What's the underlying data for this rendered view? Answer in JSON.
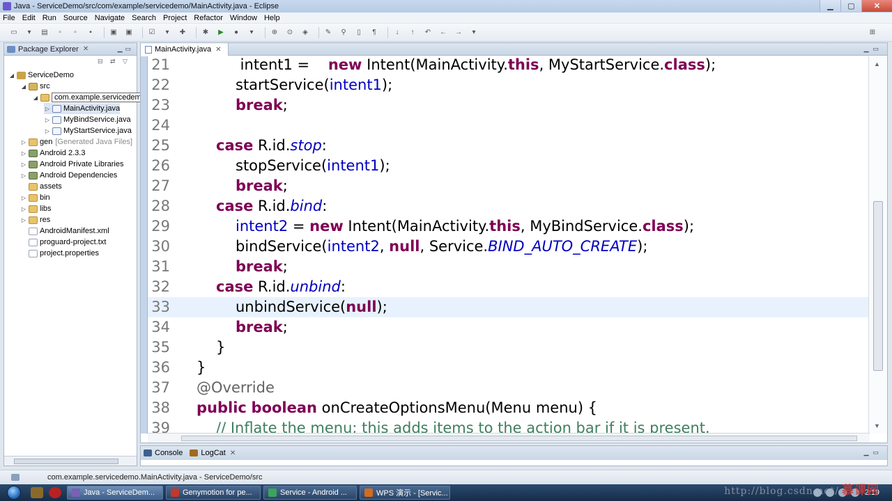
{
  "window": {
    "title": "Java - ServiceDemo/src/com/example/servicedemo/MainActivity.java - Eclipse",
    "controls": [
      "▁",
      "▢",
      "✕"
    ]
  },
  "menu": [
    "File",
    "Edit",
    "Run",
    "Source",
    "Navigate",
    "Search",
    "Project",
    "Refactor",
    "Window",
    "Help"
  ],
  "package_explorer": {
    "tab_label": "Package Explorer",
    "tab_close": "✕",
    "tree": [
      {
        "label": "ServiceDemo",
        "arrow": "◢",
        "icon": "project-icon"
      },
      {
        "label": "src",
        "arrow": "◢",
        "icon": "source-folder-icon"
      },
      {
        "label": "com.example.servicedemo",
        "arrow": "◢",
        "icon": "package-icon"
      },
      {
        "label": "MainActivity.java",
        "arrow": "▷",
        "icon": "java-file-icon"
      },
      {
        "label": "MyBindService.java",
        "arrow": "▷",
        "icon": "java-file-icon"
      },
      {
        "label": "MyStartService.java",
        "arrow": "▷",
        "icon": "java-file-icon"
      },
      {
        "label": "gen",
        "extra": "[Generated Java Files]",
        "arrow": "▷",
        "icon": "folder-icon"
      },
      {
        "label": "Android 2.3.3",
        "arrow": "▷",
        "icon": "library-icon"
      },
      {
        "label": "Android Private Libraries",
        "arrow": "▷",
        "icon": "library-icon"
      },
      {
        "label": "Android Dependencies",
        "arrow": "▷",
        "icon": "library-icon"
      },
      {
        "label": "assets",
        "arrow": "",
        "icon": "folder-icon"
      },
      {
        "label": "bin",
        "arrow": "▷",
        "icon": "folder-icon"
      },
      {
        "label": "libs",
        "arrow": "▷",
        "icon": "folder-icon"
      },
      {
        "label": "res",
        "arrow": "▷",
        "icon": "folder-icon"
      },
      {
        "label": "AndroidManifest.xml",
        "arrow": "",
        "icon": "xml-file-icon"
      },
      {
        "label": "proguard-project.txt",
        "arrow": "",
        "icon": "text-file-icon"
      },
      {
        "label": "project.properties",
        "arrow": "",
        "icon": "properties-file-icon"
      }
    ]
  },
  "editor": {
    "tab_label": "MainActivity.java",
    "tab_close": "✕",
    "current_line": 33,
    "lines": [
      {
        "num": "21",
        "tokens": [
          [
            "",
            " intent1 =    "
          ],
          [
            "kw",
            "new"
          ],
          [
            "",
            " Intent(MainActivity."
          ],
          [
            "kw",
            "this"
          ],
          [
            "",
            ", MyStartService."
          ],
          [
            "kw",
            "class"
          ],
          [
            "",
            ");"
          ]
        ],
        "indent": 2
      },
      {
        "num": "22",
        "tokens": [
          [
            "",
            "startService("
          ],
          [
            "var",
            "intent1"
          ],
          [
            "",
            ");"
          ]
        ],
        "indent": 2
      },
      {
        "num": "23",
        "tokens": [
          [
            "kw",
            "break"
          ],
          [
            "",
            ";"
          ]
        ],
        "indent": 2
      },
      {
        "num": "24",
        "tokens": [],
        "indent": 0
      },
      {
        "num": "25",
        "tokens": [
          [
            "kw",
            "case"
          ],
          [
            "",
            " R.id."
          ],
          [
            "ital",
            "stop"
          ],
          [
            "",
            ":"
          ]
        ],
        "indent": 1
      },
      {
        "num": "26",
        "tokens": [
          [
            "",
            "stopService("
          ],
          [
            "var",
            "intent1"
          ],
          [
            "",
            ");"
          ]
        ],
        "indent": 2
      },
      {
        "num": "27",
        "tokens": [
          [
            "kw",
            "break"
          ],
          [
            "",
            ";"
          ]
        ],
        "indent": 2
      },
      {
        "num": "28",
        "tokens": [
          [
            "kw",
            "case"
          ],
          [
            "",
            " R.id."
          ],
          [
            "ital",
            "bind"
          ],
          [
            "",
            ":"
          ]
        ],
        "indent": 1
      },
      {
        "num": "29",
        "tokens": [
          [
            "var",
            "intent2"
          ],
          [
            "",
            " = "
          ],
          [
            "kw",
            "new"
          ],
          [
            "",
            " Intent(MainActivity."
          ],
          [
            "kw",
            "this"
          ],
          [
            "",
            ", MyBindService."
          ],
          [
            "kw",
            "class"
          ],
          [
            "",
            ");"
          ]
        ],
        "indent": 2
      },
      {
        "num": "30",
        "tokens": [
          [
            "",
            "bindService("
          ],
          [
            "var",
            "intent2"
          ],
          [
            "",
            ", "
          ],
          [
            "kw",
            "null"
          ],
          [
            "",
            ", Service."
          ],
          [
            "ital",
            "BIND_AUTO_CREATE"
          ],
          [
            "",
            ");"
          ]
        ],
        "indent": 2
      },
      {
        "num": "31",
        "tokens": [
          [
            "kw",
            "break"
          ],
          [
            "",
            ";"
          ]
        ],
        "indent": 2
      },
      {
        "num": "32",
        "tokens": [
          [
            "kw",
            "case"
          ],
          [
            "",
            " R.id."
          ],
          [
            "ital",
            "unbind"
          ],
          [
            "",
            ":"
          ]
        ],
        "indent": 1
      },
      {
        "num": "33",
        "tokens": [
          [
            "",
            "unbindService("
          ],
          [
            "kw",
            "null"
          ],
          [
            "",
            ");"
          ]
        ],
        "indent": 2
      },
      {
        "num": "34",
        "tokens": [
          [
            "kw",
            "break"
          ],
          [
            "",
            ";"
          ]
        ],
        "indent": 2
      },
      {
        "num": "35",
        "tokens": [
          [
            "",
            "}"
          ]
        ],
        "indent": 1
      },
      {
        "num": "36",
        "tokens": [
          [
            "",
            "}"
          ]
        ],
        "indent": 0
      },
      {
        "num": "37",
        "tokens": [
          [
            "ann",
            "@Override"
          ]
        ],
        "indent": 0
      },
      {
        "num": "38",
        "tokens": [
          [
            "kw",
            "public"
          ],
          [
            "",
            " "
          ],
          [
            "kw",
            "boolean"
          ],
          [
            "",
            " onCreateOptionsMenu(Menu menu) {"
          ]
        ],
        "indent": 0,
        "fold": "▴"
      },
      {
        "num": "39",
        "tokens": [
          [
            "cmt",
            "// Inflate the menu; this adds items to the action bar if it is present."
          ]
        ],
        "indent": 1
      }
    ]
  },
  "bottom_panel": {
    "tabs": [
      {
        "label": "Console",
        "icon": "console-icon"
      },
      {
        "label": "LogCat",
        "icon": "logcat-icon",
        "close": "✕"
      }
    ]
  },
  "status": {
    "text": "com.example.servicedemo.MainActivity.java - ServiceDemo/src"
  },
  "taskbar": {
    "items": [
      {
        "label": "Java - ServiceDem...",
        "color": "#7a5fb5"
      },
      {
        "label": "Genymotion for pe...",
        "color": "#c0392b"
      },
      {
        "label": "Service - Android ...",
        "color": "#3aa55a"
      },
      {
        "label": "WPS 演示 - [Servic...",
        "color": "#d36b1e"
      }
    ],
    "clock": "2:19"
  },
  "watermark": {
    "url": "http://blog.csdn.net/",
    "brand": "慕课网"
  }
}
